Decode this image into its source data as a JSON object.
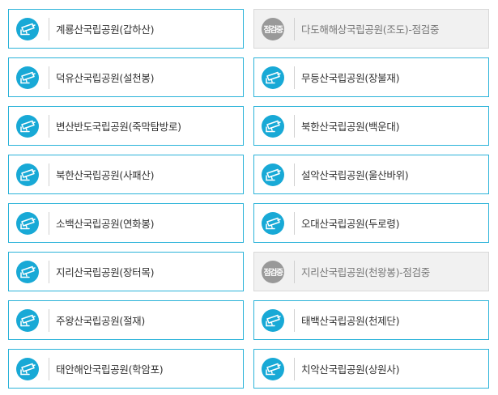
{
  "status_badge_text": "점검중",
  "icon": "cctv-camera-icon",
  "colors": {
    "active_border": "#2bb3d9",
    "active_icon": "#18a9d6",
    "inactive_background": "#f1f1f1",
    "inactive_badge": "#999999"
  },
  "cctv_list": [
    {
      "label": "계룡산국립공원(갑하산)",
      "status": "active"
    },
    {
      "label": "다도해해상국립공원(조도)-점검중",
      "status": "maintenance"
    },
    {
      "label": "덕유산국립공원(설천봉)",
      "status": "active"
    },
    {
      "label": "무등산국립공원(장불재)",
      "status": "active"
    },
    {
      "label": "변산반도국립공원(죽막탐방로)",
      "status": "active"
    },
    {
      "label": "북한산국립공원(백운대)",
      "status": "active"
    },
    {
      "label": "북한산국립공원(사패산)",
      "status": "active"
    },
    {
      "label": "설악산국립공원(울산바위)",
      "status": "active"
    },
    {
      "label": "소백산국립공원(연화봉)",
      "status": "active"
    },
    {
      "label": "오대산국립공원(두로령)",
      "status": "active"
    },
    {
      "label": "지리산국립공원(장터목)",
      "status": "active"
    },
    {
      "label": "지리산국립공원(천왕봉)-점검중",
      "status": "maintenance"
    },
    {
      "label": "주왕산국립공원(절재)",
      "status": "active"
    },
    {
      "label": "태백산국립공원(천제단)",
      "status": "active"
    },
    {
      "label": "태안해안국립공원(학암포)",
      "status": "active"
    },
    {
      "label": "치악산국립공원(상원사)",
      "status": "active"
    }
  ]
}
